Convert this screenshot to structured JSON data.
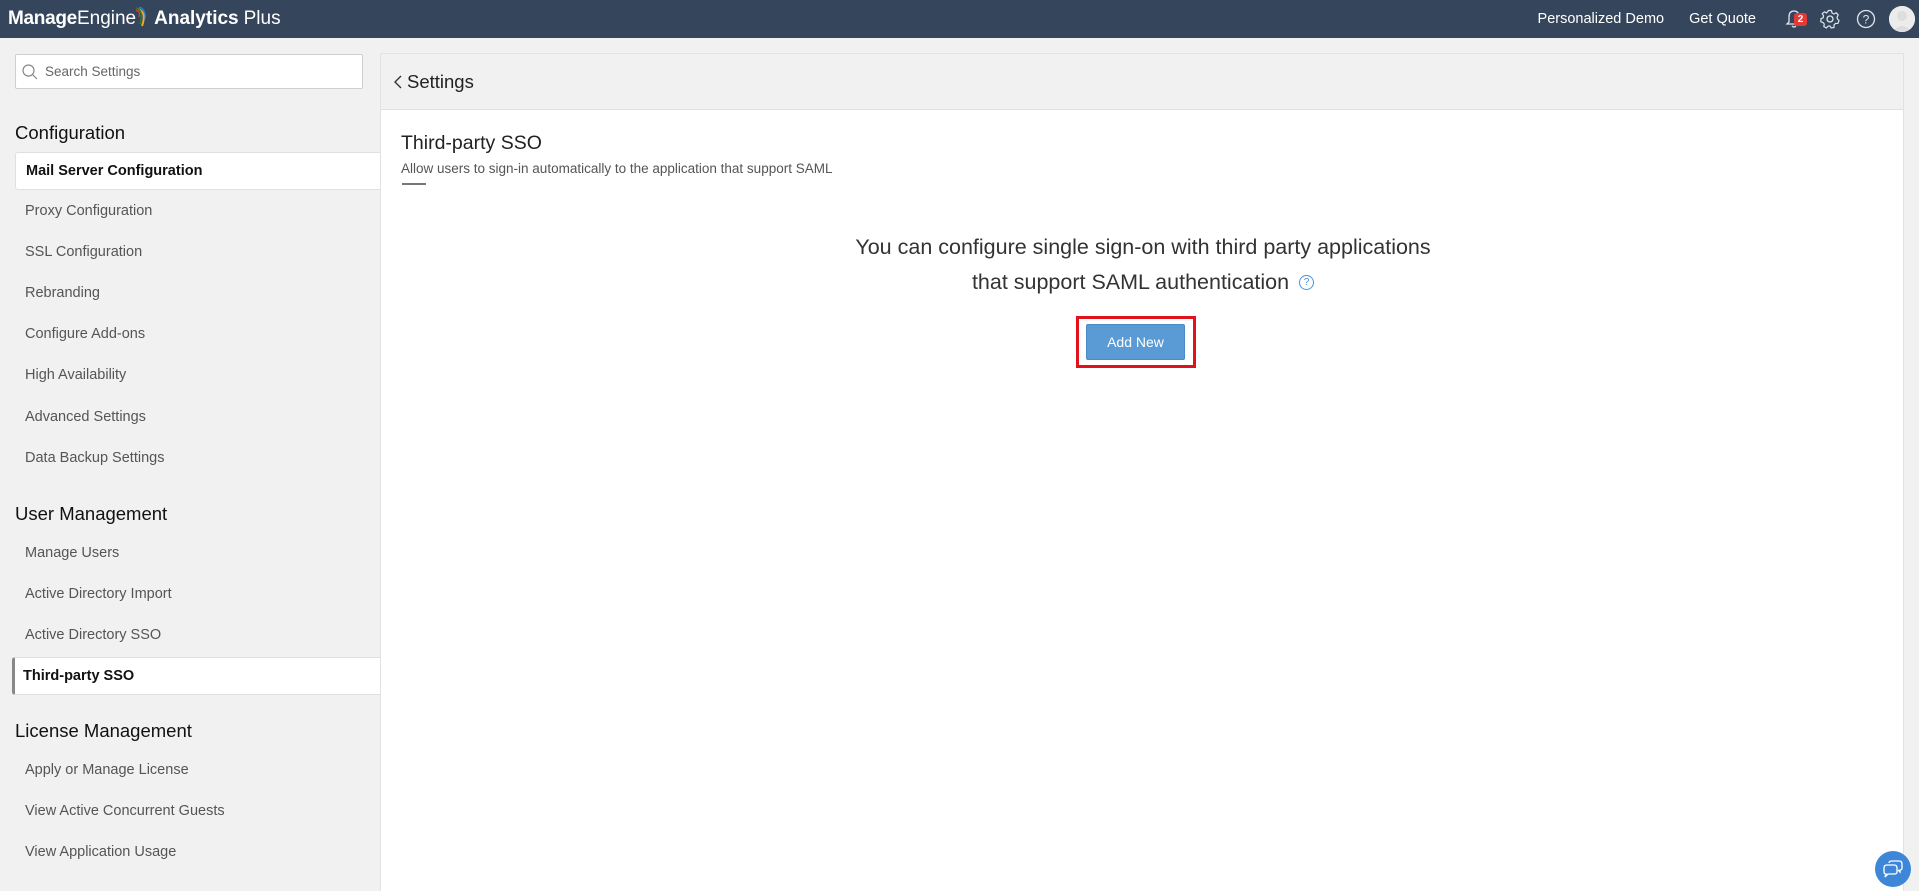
{
  "topbar": {
    "brand_part1": "Manage",
    "brand_part2": "Engine",
    "product_part1": "Analytics",
    "product_part2": "Plus",
    "links": [
      "Personalized Demo",
      "Get Quote"
    ],
    "notification_count": "2",
    "icons": [
      "bell-icon",
      "gear-icon",
      "help-icon",
      "avatar"
    ]
  },
  "sidebar": {
    "search_placeholder": "Search Settings",
    "sections": [
      {
        "title": "Configuration",
        "items": [
          {
            "label": "Mail Server Configuration",
            "active": true
          },
          {
            "label": "Proxy Configuration"
          },
          {
            "label": "SSL Configuration"
          },
          {
            "label": "Rebranding"
          },
          {
            "label": "Configure Add-ons"
          },
          {
            "label": "High Availability"
          },
          {
            "label": "Advanced Settings"
          },
          {
            "label": "Data Backup Settings"
          }
        ]
      },
      {
        "title": "User Management",
        "items": [
          {
            "label": "Manage Users"
          },
          {
            "label": "Active Directory Import"
          },
          {
            "label": "Active Directory SSO"
          },
          {
            "label": "Third-party SSO",
            "selected": true
          }
        ]
      },
      {
        "title": "License Management",
        "items": [
          {
            "label": "Apply or Manage License"
          },
          {
            "label": "View Active Concurrent Guests"
          },
          {
            "label": "View Application Usage"
          }
        ]
      }
    ]
  },
  "main": {
    "back_label": "Settings",
    "title": "Third-party SSO",
    "description": "Allow users to sign-in automatically to the application that support SAML",
    "info_line1": "You can configure single sign-on with third party applications",
    "info_line2": "that support SAML authentication",
    "help_glyph": "?",
    "add_button": "Add New"
  },
  "colors": {
    "topbar_bg": "#35465c",
    "primary_button": "#5a9bd5",
    "highlight_border": "#e0131c",
    "badge": "#e53935",
    "chat_fab": "#3d86d8"
  }
}
